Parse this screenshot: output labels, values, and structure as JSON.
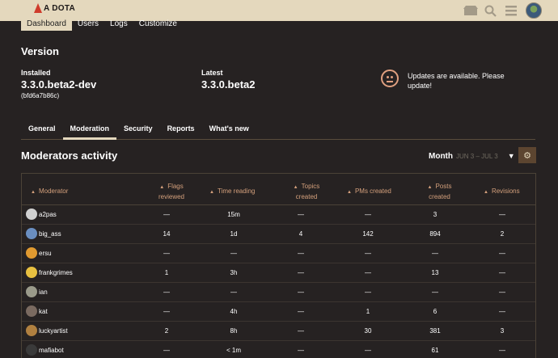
{
  "header": {
    "logo_text": "A DOTA",
    "icons": [
      "store-icon",
      "search-icon",
      "hamburger-icon",
      "avatar"
    ]
  },
  "nav": {
    "tabs": [
      "Dashboard",
      "Users",
      "Logs",
      "Customize"
    ],
    "active": "Dashboard"
  },
  "version": {
    "title": "Version",
    "installed_label": "Installed",
    "installed_value": "3.3.0.beta2-dev",
    "installed_hash": "(bfd6a7b86c)",
    "latest_label": "Latest",
    "latest_value": "3.3.0.beta2",
    "update_message": "Updates are available. Please update!"
  },
  "subtabs": [
    "General",
    "Moderation",
    "Security",
    "Reports",
    "What's new"
  ],
  "moderators": {
    "title": "Moderators activity",
    "period_label": "Month",
    "period_range": "JUN 3 – JUL 3",
    "columns": [
      "Moderator",
      "Flags reviewed",
      "Time reading",
      "Topics created",
      "PMs created",
      "Posts created",
      "Revisions"
    ],
    "rows": [
      {
        "name": "a2pas",
        "flags": "—",
        "time": "15m",
        "topics": "—",
        "pms": "—",
        "posts": "3",
        "revisions": "—",
        "avatar_color": "#d0d0d0"
      },
      {
        "name": "big_ass",
        "flags": "14",
        "time": "1d",
        "topics": "4",
        "pms": "142",
        "posts": "894",
        "revisions": "2",
        "avatar_color": "#6a8ec0"
      },
      {
        "name": "ersu",
        "flags": "—",
        "time": "—",
        "topics": "—",
        "pms": "—",
        "posts": "—",
        "revisions": "—",
        "avatar_color": "#e09a30"
      },
      {
        "name": "frankgrimes",
        "flags": "1",
        "time": "3h",
        "topics": "—",
        "pms": "—",
        "posts": "13",
        "revisions": "—",
        "avatar_color": "#e8c040"
      },
      {
        "name": "ian",
        "flags": "—",
        "time": "—",
        "topics": "—",
        "pms": "—",
        "posts": "—",
        "revisions": "—",
        "avatar_color": "#9a9a8a"
      },
      {
        "name": "kat",
        "flags": "—",
        "time": "4h",
        "topics": "—",
        "pms": "1",
        "posts": "6",
        "revisions": "—",
        "avatar_color": "#7a6a60"
      },
      {
        "name": "luckyartist",
        "flags": "2",
        "time": "8h",
        "topics": "—",
        "pms": "30",
        "posts": "381",
        "revisions": "3",
        "avatar_color": "#b08040"
      },
      {
        "name": "mafiabot",
        "flags": "—",
        "time": "< 1m",
        "topics": "—",
        "pms": "—",
        "posts": "61",
        "revisions": "—",
        "avatar_color": "#3a3a3a"
      }
    ]
  },
  "colors": {
    "header_bg": "#e4d8bd",
    "page_bg": "#262222",
    "accent": "#d4a07c"
  }
}
